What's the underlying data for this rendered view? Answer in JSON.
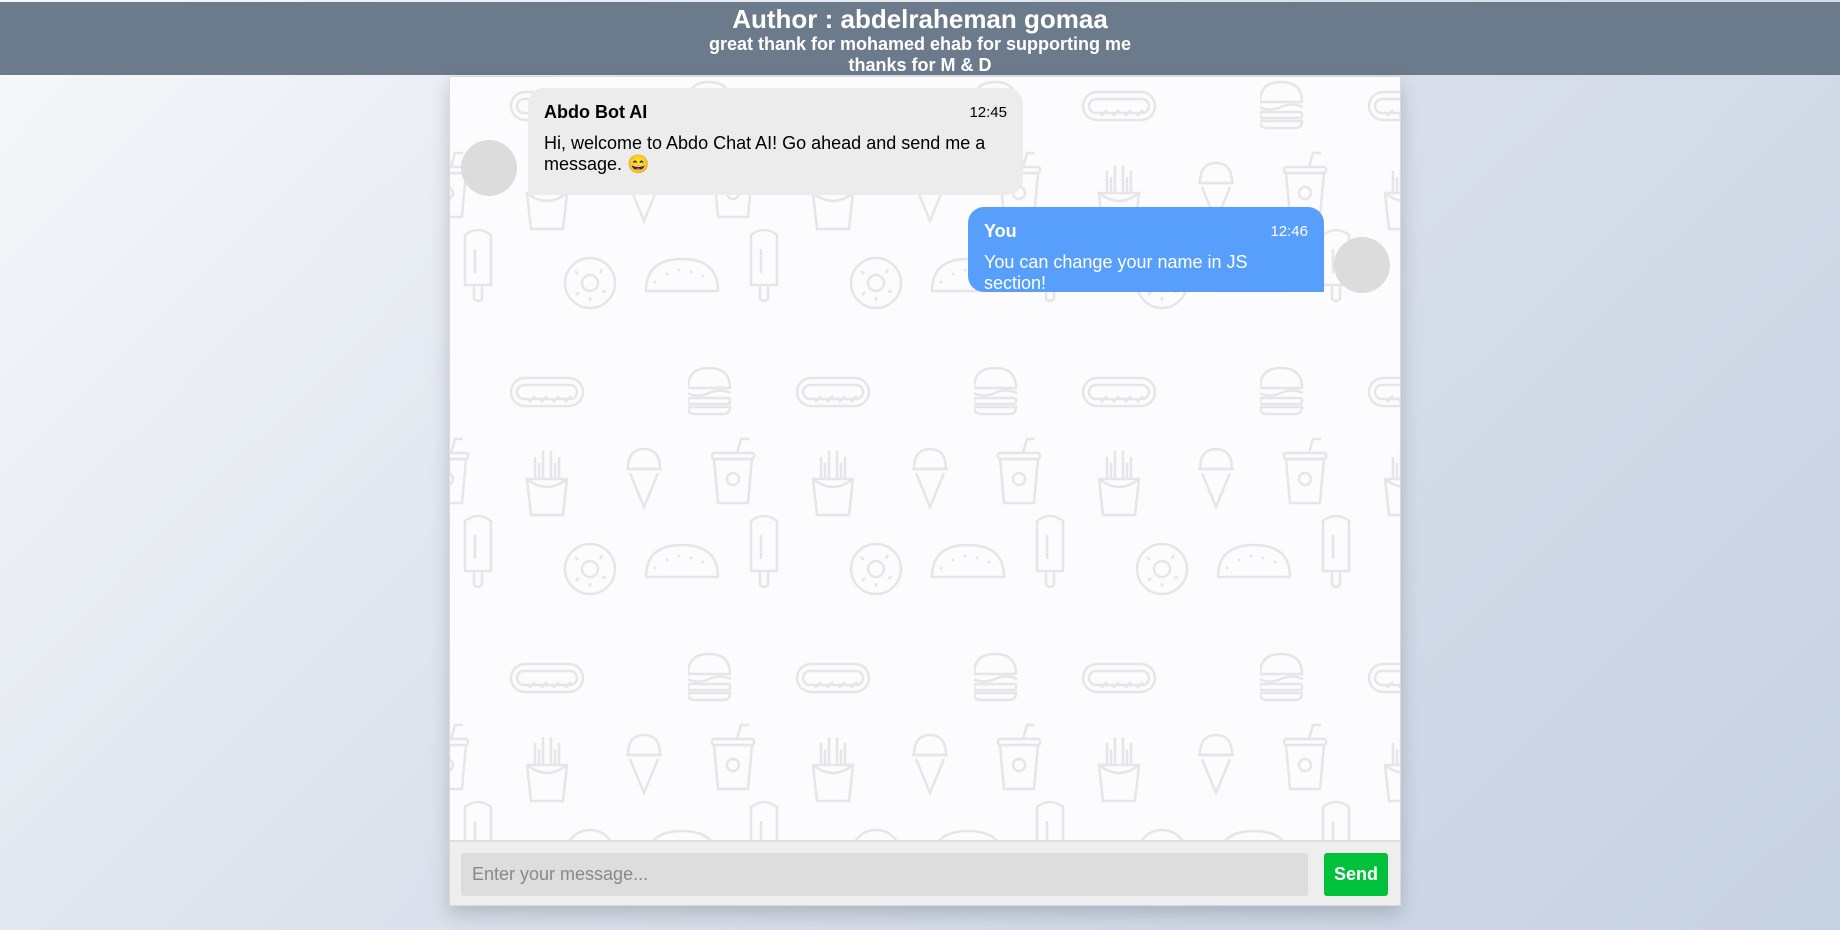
{
  "header": {
    "title": "Author : abdelraheman gomaa",
    "subtitle": "great thank for mohamed ehab for supporting me",
    "thanks": "thanks for M & D"
  },
  "messages": [
    {
      "sender": "Abdo Bot AI",
      "time": "12:45",
      "text": "Hi, welcome to Abdo Chat AI! Go ahead and send me a message. 😄",
      "side": "left"
    },
    {
      "sender": "You",
      "time": "12:46",
      "text": "You can change your name in JS section!",
      "side": "right"
    }
  ],
  "composer": {
    "placeholder": "Enter your message...",
    "send_label": "Send"
  },
  "colors": {
    "header_bg": "#6c7b8b",
    "bot_bubble": "#ececec",
    "user_bubble": "#579ffb",
    "send_button": "#00c13c",
    "avatar": "#dcdcdc"
  },
  "background_pattern_icons": [
    "burger-icon",
    "hotdog-icon",
    "soda-cup-icon",
    "fries-icon",
    "ice-cream-icon",
    "popsicle-icon",
    "donut-icon",
    "taco-icon"
  ]
}
